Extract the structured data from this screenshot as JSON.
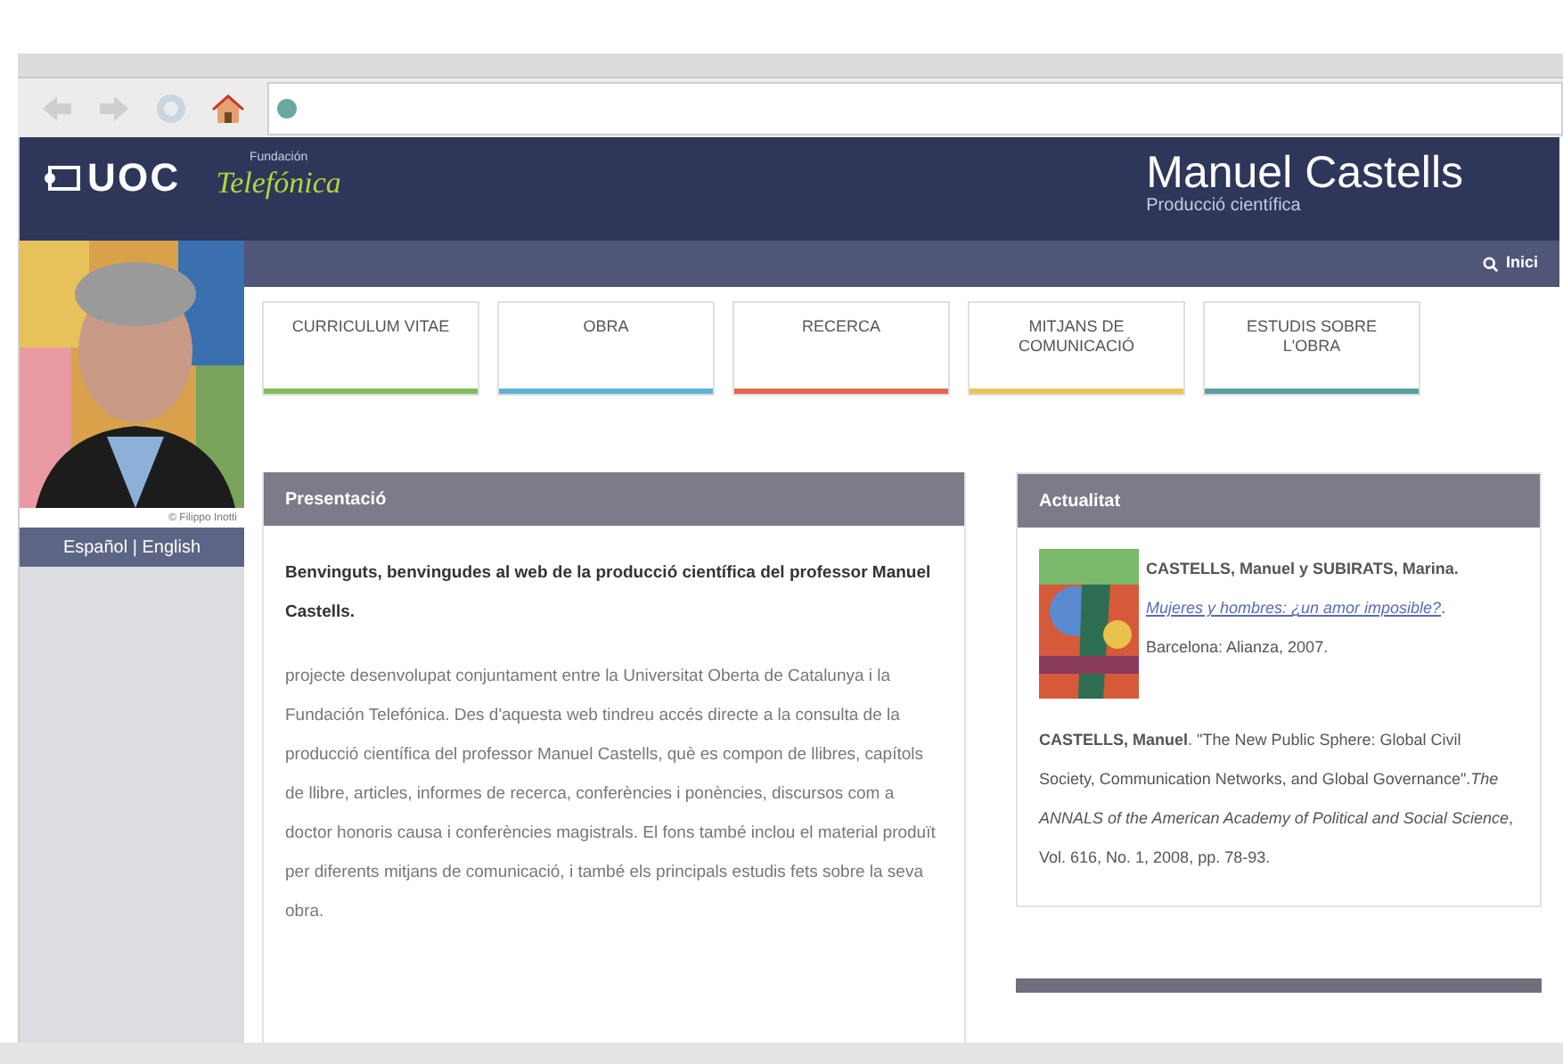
{
  "site": {
    "logo": "UOC",
    "partner_small": "Fundación",
    "partner": "Telefónica",
    "title": "Manuel Castells",
    "subtitle": "Producció científica",
    "home_link": "Inici"
  },
  "sidebar": {
    "photo_credit": "© Filippo Inotti",
    "languages": "Español | English"
  },
  "tabs": [
    {
      "label": "CURRICULUM VITAE",
      "color": "#7fbf5a"
    },
    {
      "label": "OBRA",
      "color": "#5fb3d6"
    },
    {
      "label": "RECERCA",
      "color": "#e06a4e"
    },
    {
      "label": "MITJANS DE COMUNICACIÓ",
      "color": "#e8c45a"
    },
    {
      "label": "ESTUDIS SOBRE L'OBRA",
      "color": "#5a9fa0"
    }
  ],
  "presentation": {
    "heading": "Presentació",
    "intro": "Benvinguts, benvingudes al web de la producció científica del professor Manuel Castells.",
    "body": "projecte desenvolupat conjuntament entre la Universitat Oberta de Catalunya i la Fundación Telefónica. Des d'aquesta web tindreu accés directe a la consulta de la producció científica del professor Manuel Castells, què es compon de llibres, capítols de llibre, articles, informes de recerca, conferències i ponències, discursos com a doctor honoris causa i conferències magistrals. El fons també inclou el material produït per diferents mitjans de comunicació, i també els principals estudis fets sobre la seva obra."
  },
  "news": {
    "heading": "Actualitat",
    "items": [
      {
        "kind": "book",
        "before": "**CASTELLS, Manuel y SUBIRATS, Marina.** ",
        "link": "Mujeres y hombres: ¿un amor imposible?",
        "after": ". Barcelona: Alianza, 2007."
      },
      {
        "kind": "article",
        "text": "**CASTELLS, Manuel**. \"The New Public Sphere: Global Civil Society, Communication Networks, and Global Governance\".*The ANNALS of the American Academy of Political and Social Science*, Vol. 616, No. 1, 2008, pp. 78-93."
      }
    ]
  }
}
